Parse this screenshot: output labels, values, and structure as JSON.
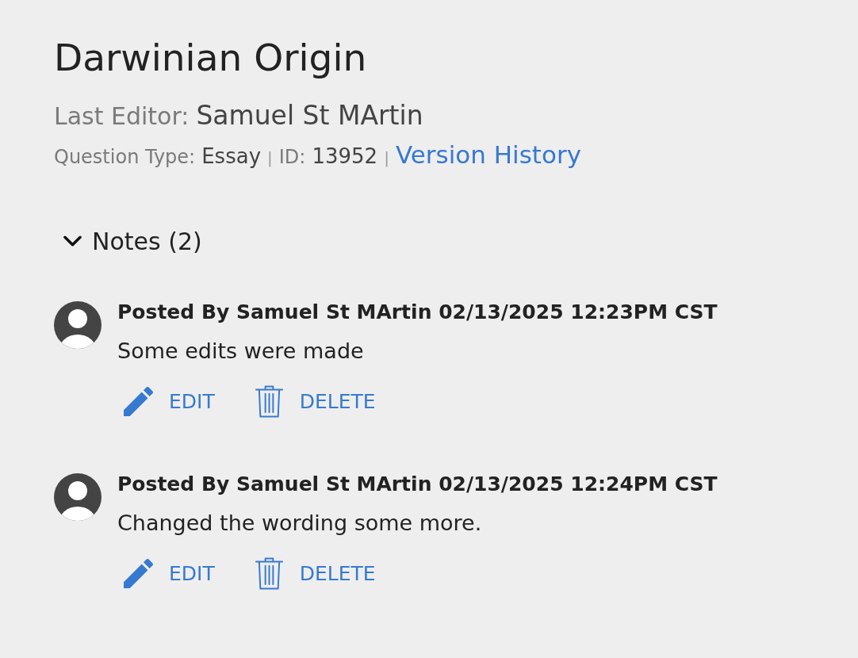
{
  "title": "Darwinian Origin",
  "last_editor": {
    "label": "Last Editor:",
    "value": "Samuel St MArtin"
  },
  "meta": [
    {
      "kind": "field",
      "label": "Question Type:",
      "value": "Essay"
    },
    {
      "kind": "separator",
      "text": "|"
    },
    {
      "kind": "field",
      "label": "ID:",
      "value": "13952"
    },
    {
      "kind": "separator",
      "text": "|"
    },
    {
      "kind": "link",
      "text": "Version History"
    }
  ],
  "notes": {
    "label": "Notes (2)",
    "expanded": true,
    "items": [
      {
        "header": "Posted By Samuel St MArtin 02/13/2025 12:23PM CST",
        "body": "Some edits were made",
        "actions": [
          {
            "kind": "edit",
            "label": "EDIT"
          },
          {
            "kind": "delete",
            "label": "DELETE"
          }
        ]
      },
      {
        "header": "Posted By Samuel St MArtin 02/13/2025 12:24PM CST",
        "body": "Changed the wording some more.",
        "actions": [
          {
            "kind": "edit",
            "label": "EDIT"
          },
          {
            "kind": "delete",
            "label": "DELETE"
          }
        ]
      }
    ]
  }
}
